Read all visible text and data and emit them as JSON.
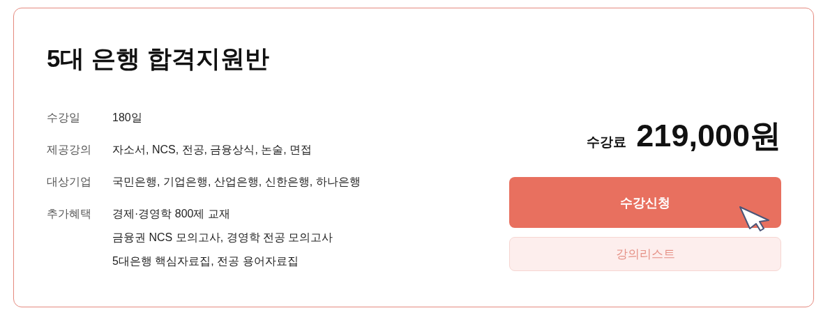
{
  "title": "5대 은행 합격지원반",
  "details": [
    {
      "label": "수강일",
      "values": [
        "180일"
      ]
    },
    {
      "label": "제공강의",
      "values": [
        "자소서, NCS, 전공, 금융상식, 논술, 면접"
      ]
    },
    {
      "label": "대상기업",
      "values": [
        "국민은행, 기업은행, 산업은행, 신한은행, 하나은행"
      ]
    },
    {
      "label": "추가혜택",
      "values": [
        "경제·경영학 800제 교재",
        "금융권 NCS 모의고사, 경영학 전공 모의고사",
        "5대은행 핵심자료집, 전공 용어자료집"
      ]
    }
  ],
  "price": {
    "label": "수강료",
    "amount": "219,000원"
  },
  "buttons": [
    {
      "kind": "primary",
      "label": "수강신청"
    },
    {
      "kind": "secondary",
      "label": "강의리스트"
    }
  ]
}
